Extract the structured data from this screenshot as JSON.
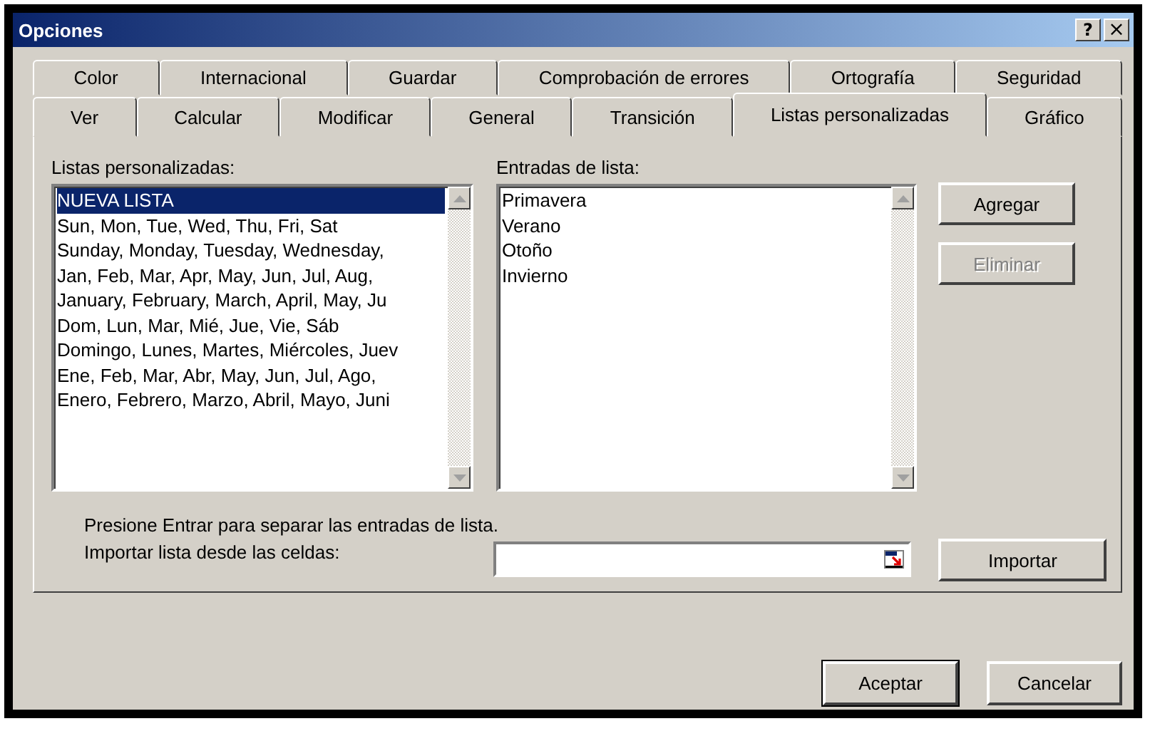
{
  "window": {
    "title": "Opciones",
    "title_buttons": [
      {
        "label": "?",
        "kind": "help"
      },
      {
        "label": "×",
        "kind": "close"
      }
    ]
  },
  "tab_rows": [
    [
      {
        "label": "Color",
        "selected": false
      },
      {
        "label": "Internacional",
        "selected": false
      },
      {
        "label": "Guardar",
        "selected": false
      },
      {
        "label": "Comprobación de errores",
        "selected": false
      },
      {
        "label": "Ortografía",
        "selected": false
      },
      {
        "label": "Seguridad",
        "selected": false
      }
    ],
    [
      {
        "label": "Ver",
        "selected": false
      },
      {
        "label": "Calcular",
        "selected": false
      },
      {
        "label": "Modificar",
        "selected": false
      },
      {
        "label": "General",
        "selected": false
      },
      {
        "label": "Transición",
        "selected": false
      },
      {
        "label": "Listas personalizadas",
        "selected": true
      },
      {
        "label": "Gráfico",
        "selected": false
      }
    ]
  ],
  "custom_lists": {
    "label": "Listas personalizadas:",
    "items": [
      {
        "text": "NUEVA LISTA",
        "selected": true
      },
      {
        "text": "Sun, Mon, Tue, Wed, Thu, Fri, Sat",
        "selected": false
      },
      {
        "text": "Sunday, Monday, Tuesday, Wednesday,",
        "selected": false
      },
      {
        "text": "Jan, Feb, Mar, Apr, May, Jun, Jul, Aug,",
        "selected": false
      },
      {
        "text": "January, February, March, April, May, Ju",
        "selected": false
      },
      {
        "text": "Dom, Lun, Mar, Mié, Jue, Vie, Sáb",
        "selected": false
      },
      {
        "text": "Domingo, Lunes, Martes, Miércoles, Juev",
        "selected": false
      },
      {
        "text": "Ene, Feb, Mar, Abr, May, Jun, Jul, Ago,",
        "selected": false
      },
      {
        "text": "Enero, Febrero, Marzo, Abril, Mayo, Juni",
        "selected": false
      }
    ]
  },
  "list_entries": {
    "label": "Entradas de lista:",
    "value": [
      "Primavera",
      "Verano",
      "Otoño",
      "Invierno"
    ]
  },
  "side_buttons": [
    {
      "label": "Agregar",
      "disabled": false
    },
    {
      "label": "Eliminar",
      "disabled": true
    }
  ],
  "hint": "Presione Entrar para separar las entradas de lista.",
  "import": {
    "label": "Importar lista desde las celdas:",
    "button": "Importar"
  },
  "footer_buttons": [
    {
      "label": "Aceptar",
      "default": true
    },
    {
      "label": "Cancelar",
      "default": false
    }
  ]
}
